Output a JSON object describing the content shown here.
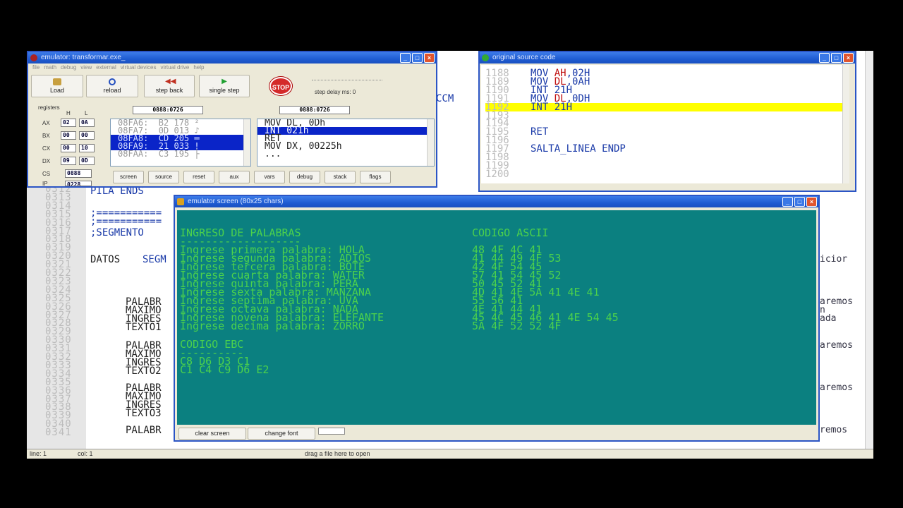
{
  "editor": {
    "line_numbers": [
      "0312",
      "0313",
      "0314",
      "0315",
      "0316",
      "0317",
      "0318",
      "0319",
      "0320",
      "0321",
      "0322",
      "0323",
      "0324",
      "0325",
      "0326",
      "0327",
      "0328",
      "0329",
      "0330",
      "0331",
      "0332",
      "0333",
      "0334",
      "0335",
      "0336",
      "0337",
      "0338",
      "0339",
      "0340",
      "0341"
    ],
    "pila_ends": "PILA ENDS",
    "dash1": ";===========",
    "dash2": ";===========",
    "segmento": ";SEGMENTO",
    "datos": "DATOS",
    "segm": "SEGM",
    "palabr": "PALABR",
    "maximo": "MAXIMO",
    "ingres": "INGRES",
    "texto1": "TEXTO1",
    "texto2": "TEXTO2",
    "texto3": "TEXTO3",
    "ccm": "CCM",
    "right_texts": [
      "icior",
      "aremos",
      "n",
      "ada",
      "aremos",
      "aremos",
      "remos"
    ],
    "status": {
      "line": "line: 1",
      "col": "col: 1",
      "drag": "drag a file here to open"
    }
  },
  "emulator": {
    "title": "emulator: transformar.exe_",
    "menu": [
      "file",
      "math",
      "debug",
      "view",
      "external",
      "virtual devices",
      "virtual drive",
      "help"
    ],
    "tools": {
      "load": "Load",
      "reload": "reload",
      "step_back": "step back",
      "single_step": "single step",
      "stop": "STOP",
      "step_delay": "step delay ms: 0"
    },
    "registers_label": "registers",
    "h_label": "H",
    "l_label": "L",
    "registers": [
      {
        "name": "AX",
        "h": "02",
        "l": "0A"
      },
      {
        "name": "BX",
        "h": "00",
        "l": "00"
      },
      {
        "name": "CX",
        "h": "00",
        "l": "10"
      },
      {
        "name": "DX",
        "h": "09",
        "l": "0D"
      }
    ],
    "cs_label": "CS",
    "cs": "0888",
    "ip_label": "IP",
    "ip": "0228",
    "addr_left": "0888:0726",
    "addr_right": "0888:0726",
    "memory": [
      {
        "text": "08FA6:  B2 178 ²",
        "sel": false
      },
      {
        "text": "08FA7:  0D 013 ♪",
        "sel": false
      },
      {
        "text": "08FA8:  CD 205 ═",
        "sel": true
      },
      {
        "text": "08FA9:  21 033 !",
        "sel": true
      },
      {
        "text": "08FAA:  C3 195 ├",
        "sel": false
      }
    ],
    "disasm": [
      {
        "text": "MOV DL, 0Dh",
        "sel": false
      },
      {
        "text": "INT 021h",
        "sel": true
      },
      {
        "text": "RET",
        "sel": false
      },
      {
        "text": "MOV DX, 00225h",
        "sel": false
      },
      {
        "text": "...",
        "sel": false
      }
    ],
    "buttons": [
      "screen",
      "source",
      "reset",
      "aux",
      "vars",
      "debug",
      "stack",
      "flags"
    ]
  },
  "source": {
    "title": "original source code",
    "lines": [
      {
        "n": "1188",
        "parts": [
          [
            "MOV ",
            "blu"
          ],
          [
            "AH",
            "red"
          ],
          [
            ",02H",
            "blu"
          ]
        ],
        "hl": false
      },
      {
        "n": "1189",
        "parts": [
          [
            "MOV ",
            "blu"
          ],
          [
            "DL",
            "red"
          ],
          [
            ",0AH",
            "blu"
          ]
        ],
        "hl": false
      },
      {
        "n": "1190",
        "parts": [
          [
            "INT 21H",
            "blu"
          ]
        ],
        "hl": false
      },
      {
        "n": "1191",
        "parts": [
          [
            "MOV ",
            "blu"
          ],
          [
            "DL",
            "red"
          ],
          [
            ",0DH",
            "blu"
          ]
        ],
        "hl": false
      },
      {
        "n": "1192",
        "parts": [
          [
            "INT 21H",
            "blu"
          ]
        ],
        "hl": true
      },
      {
        "n": "1193",
        "parts": [],
        "hl": false
      },
      {
        "n": "1194",
        "parts": [],
        "hl": false
      },
      {
        "n": "1195",
        "parts": [
          [
            "RET",
            "blu"
          ]
        ],
        "hl": false
      },
      {
        "n": "1196",
        "parts": [],
        "hl": false
      },
      {
        "n": "1197",
        "parts": [
          [
            "SALTA_LINEA ENDP",
            "blu"
          ]
        ],
        "hl": false
      },
      {
        "n": "1198",
        "parts": [],
        "hl": false
      },
      {
        "n": "1199",
        "parts": [],
        "hl": false
      },
      {
        "n": "1200",
        "parts": [],
        "hl": false
      }
    ]
  },
  "screen": {
    "title": "emulator screen (80x25 chars)",
    "heading_left": "INGRESO DE PALABRAS",
    "heading_right": "CODIGO ASCII",
    "underline": "-------------------",
    "words": [
      {
        "prompt": "Ingrese primera palabra: HOLA",
        "ascii": "48 4F 4C 41"
      },
      {
        "prompt": "Ingrese segunda palabra: ADIOS",
        "ascii": "41 44 49 4F 53"
      },
      {
        "prompt": "Ingrese tercera palabra: BOTE",
        "ascii": "42 4F 54 45"
      },
      {
        "prompt": "Ingrese cuarta palabra: WATER",
        "ascii": "57 41 54 45 52"
      },
      {
        "prompt": "Ingrese quinta palabra: PERA",
        "ascii": "50 45 52 41"
      },
      {
        "prompt": "Ingrese sexta palabra: MANZANA",
        "ascii": "4D 41 4E 5A 41 4E 41"
      },
      {
        "prompt": "Ingrese septima palabra: UVA",
        "ascii": "55 56 41"
      },
      {
        "prompt": "Ingrese octava palabra: NADA",
        "ascii": "4E 41 44 41"
      },
      {
        "prompt": "Ingrese novena palabra: ELEFANTE",
        "ascii": "45 4C 45 46 41 4E 54 45"
      },
      {
        "prompt": "Ingrese decima palabra: ZORRO",
        "ascii": "5A 4F 52 52 4F"
      }
    ],
    "ebc_heading": "CODIGO EBC",
    "ebc_underline": "----------",
    "ebc_lines": [
      "C8 D6 D3 C1",
      "C1 C4 C9 D6 E2"
    ],
    "buttons": {
      "clear": "clear screen",
      "font": "change font"
    },
    "colors": {
      "bg": "#0b8080",
      "text": "#4cd14c"
    }
  }
}
